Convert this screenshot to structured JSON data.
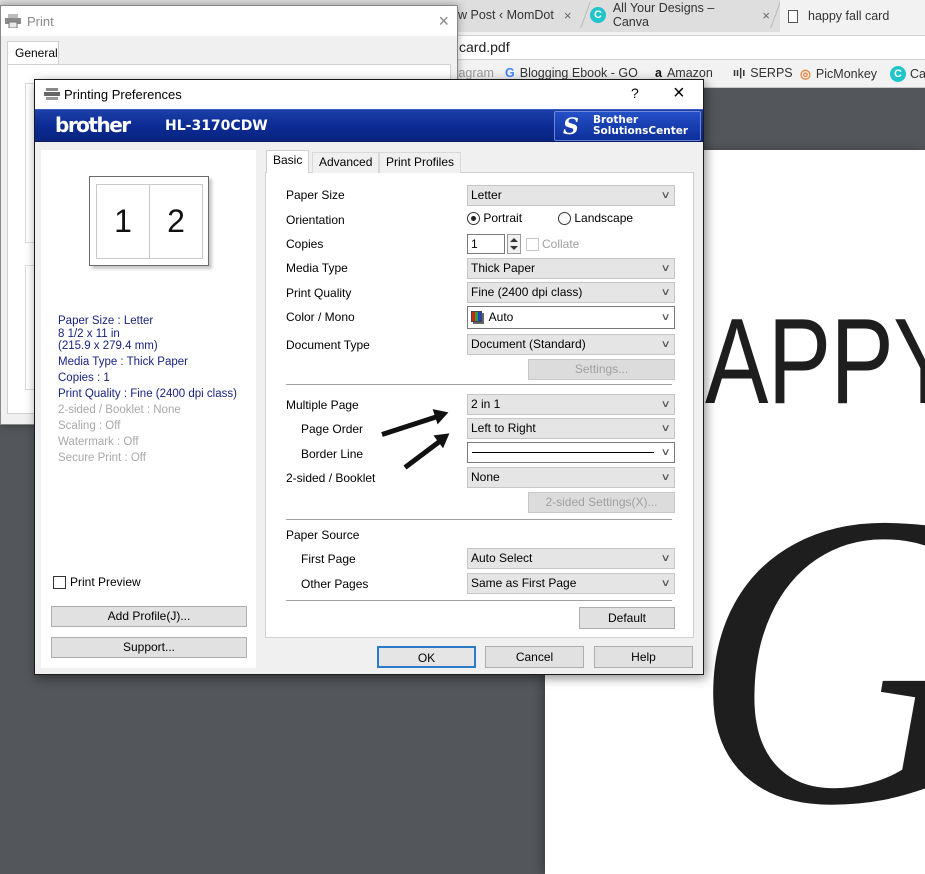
{
  "browser": {
    "tabs": [
      {
        "label": "w Post ‹ MomDot",
        "close": "×"
      },
      {
        "label": "All Your Designs – Canva",
        "close": "×",
        "icon": "canva-icon"
      },
      {
        "label": "happy fall card",
        "icon": "document-icon"
      }
    ],
    "address": "card.pdf",
    "bookmarks": [
      {
        "label": "tagram",
        "icon": "instagram-icon"
      },
      {
        "label": "Blogging Ebook - GO",
        "icon": "google-icon",
        "glyph": "G"
      },
      {
        "label": "Amazon",
        "icon": "amazon-icon",
        "glyph": "a"
      },
      {
        "label": "SERPS",
        "icon": "serps-icon",
        "glyph": "ıı|ı"
      },
      {
        "label": "PicMonkey",
        "icon": "picmonkey-icon",
        "glyph": "◎"
      },
      {
        "label": "Ca",
        "icon": "canva-icon",
        "glyph": "C"
      }
    ],
    "pdf": {
      "line1": "APPY",
      "line2": "G'"
    }
  },
  "print_dialog": {
    "title": "Print",
    "close": "×",
    "tab": "General"
  },
  "prefs": {
    "title": "Printing Preferences",
    "help": "?",
    "close": "×",
    "brand": "brother",
    "model": "HL-3170CDW",
    "solutions_line1": "Brother",
    "solutions_line2": "SolutionsCenter",
    "preview": {
      "page1": "1",
      "page2": "2"
    },
    "summary": [
      {
        "text": "Paper Size : Letter\n8 1/2 x 11 in\n(215.9 x 279.4 mm)",
        "enabled": true
      },
      {
        "text": "Media Type : Thick Paper",
        "enabled": true
      },
      {
        "text": "Copies : 1",
        "enabled": true
      },
      {
        "text": "Print Quality : Fine (2400 dpi class)",
        "enabled": true
      },
      {
        "text": "2-sided / Booklet : None",
        "enabled": false
      },
      {
        "text": "Scaling : Off",
        "enabled": false
      },
      {
        "text": "Watermark : Off",
        "enabled": false
      },
      {
        "text": "Secure Print : Off",
        "enabled": false
      }
    ],
    "print_preview_label": "Print Preview",
    "print_preview_checked": false,
    "add_profile": "Add Profile(J)...",
    "support": "Support...",
    "tabs": [
      "Basic",
      "Advanced",
      "Print Profiles"
    ],
    "active_tab": "Basic",
    "basic": {
      "paper_size": {
        "label": "Paper Size",
        "value": "Letter"
      },
      "orientation": {
        "label": "Orientation",
        "options": [
          "Portrait",
          "Landscape"
        ],
        "selected": "Portrait"
      },
      "copies": {
        "label": "Copies",
        "value": "1",
        "collate_label": "Collate",
        "collate_checked": false
      },
      "media_type": {
        "label": "Media Type",
        "value": "Thick Paper"
      },
      "print_quality": {
        "label": "Print Quality",
        "value": "Fine (2400 dpi class)"
      },
      "color_mono": {
        "label": "Color / Mono",
        "value": "Auto"
      },
      "document_type": {
        "label": "Document Type",
        "value": "Document (Standard)"
      },
      "settings_button": "Settings...",
      "multiple_page": {
        "label": "Multiple Page",
        "value": "2 in 1"
      },
      "page_order": {
        "label": "Page Order",
        "value": "Left to Right"
      },
      "border_line": {
        "label": "Border Line",
        "value": "solid line"
      },
      "two_sided": {
        "label": "2-sided / Booklet",
        "value": "None"
      },
      "two_sided_settings": "2-sided Settings(X)...",
      "paper_source": {
        "label": "Paper Source"
      },
      "first_page": {
        "label": "First Page",
        "value": "Auto Select"
      },
      "other_pages": {
        "label": "Other Pages",
        "value": "Same as First Page"
      },
      "default_button": "Default"
    },
    "buttons": {
      "ok": "OK",
      "cancel": "Cancel",
      "help": "Help"
    },
    "chevron": "∨"
  },
  "colors": {
    "brand_blue": "#0b2a92",
    "summary_text": "#1a237e",
    "ok_focus": "#2b7bc6",
    "viewer_bg": "#53565a"
  }
}
